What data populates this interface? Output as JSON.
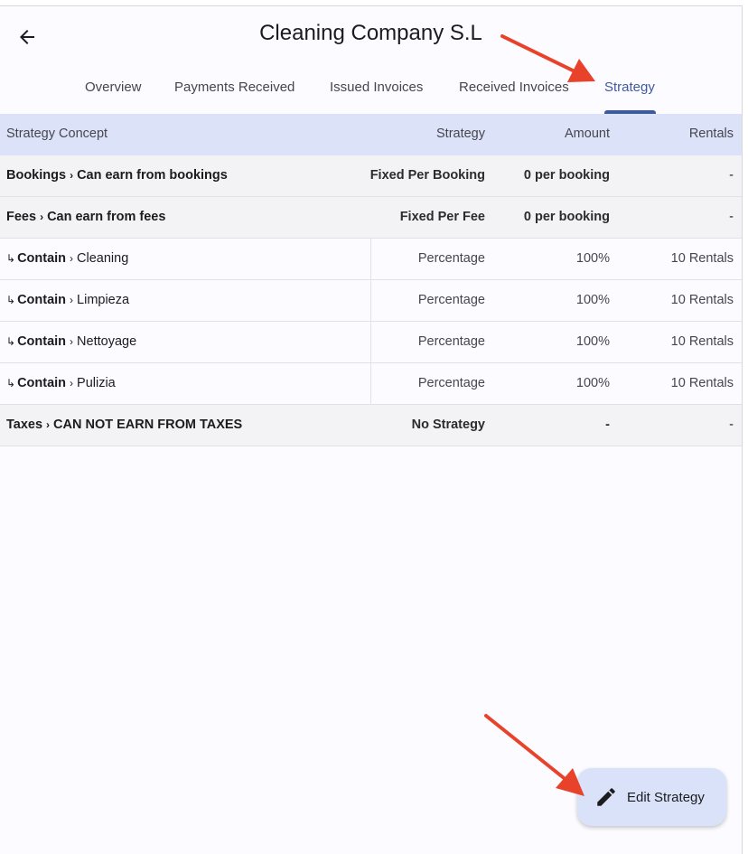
{
  "header": {
    "back_icon": "arrow-left-icon",
    "title": "Cleaning Company S.L"
  },
  "tabs": [
    {
      "label": "Overview",
      "active": false
    },
    {
      "label": "Payments Received",
      "active": false
    },
    {
      "label": "Issued Invoices",
      "active": false
    },
    {
      "label": "Received Invoices",
      "active": false
    },
    {
      "label": "Strategy",
      "active": true
    }
  ],
  "table": {
    "headers": {
      "concept": "Strategy Concept",
      "strategy": "Strategy",
      "amount": "Amount",
      "rentals": "Rentals"
    },
    "rows": [
      {
        "prefix": "",
        "main": "Bookings",
        "sep": "›",
        "sub": "Can earn from bookings",
        "strategy": "Fixed Per Booking",
        "amount": "0 per booking",
        "rentals": "-"
      },
      {
        "prefix": "",
        "main": "Fees",
        "sep": "›",
        "sub": "Can earn from fees",
        "strategy": "Fixed Per Fee",
        "amount": "0 per booking",
        "rentals": "-"
      },
      {
        "prefix": "↳",
        "main": "Contain",
        "sep": "›",
        "sub": "Cleaning",
        "strategy": "Percentage",
        "amount": "100%",
        "rentals": "10 Rentals"
      },
      {
        "prefix": "↳",
        "main": "Contain",
        "sep": "›",
        "sub": "Limpieza",
        "strategy": "Percentage",
        "amount": "100%",
        "rentals": "10 Rentals"
      },
      {
        "prefix": "↳",
        "main": "Contain",
        "sep": "›",
        "sub": "Nettoyage",
        "strategy": "Percentage",
        "amount": "100%",
        "rentals": "10 Rentals"
      },
      {
        "prefix": "↳",
        "main": "Contain",
        "sep": "›",
        "sub": "Pulizia",
        "strategy": "Percentage",
        "amount": "100%",
        "rentals": "10 Rentals"
      },
      {
        "prefix": "",
        "main": "Taxes",
        "sep": "›",
        "sub": "CAN NOT EARN FROM TAXES",
        "strategy": "No Strategy",
        "amount": "-",
        "rentals": "-"
      }
    ]
  },
  "fab": {
    "icon": "pencil-icon",
    "label": "Edit Strategy"
  },
  "colors": {
    "accent": "#3d5a9a",
    "header_row": "#dce3f8",
    "annotation_arrow": "#e8432a"
  }
}
